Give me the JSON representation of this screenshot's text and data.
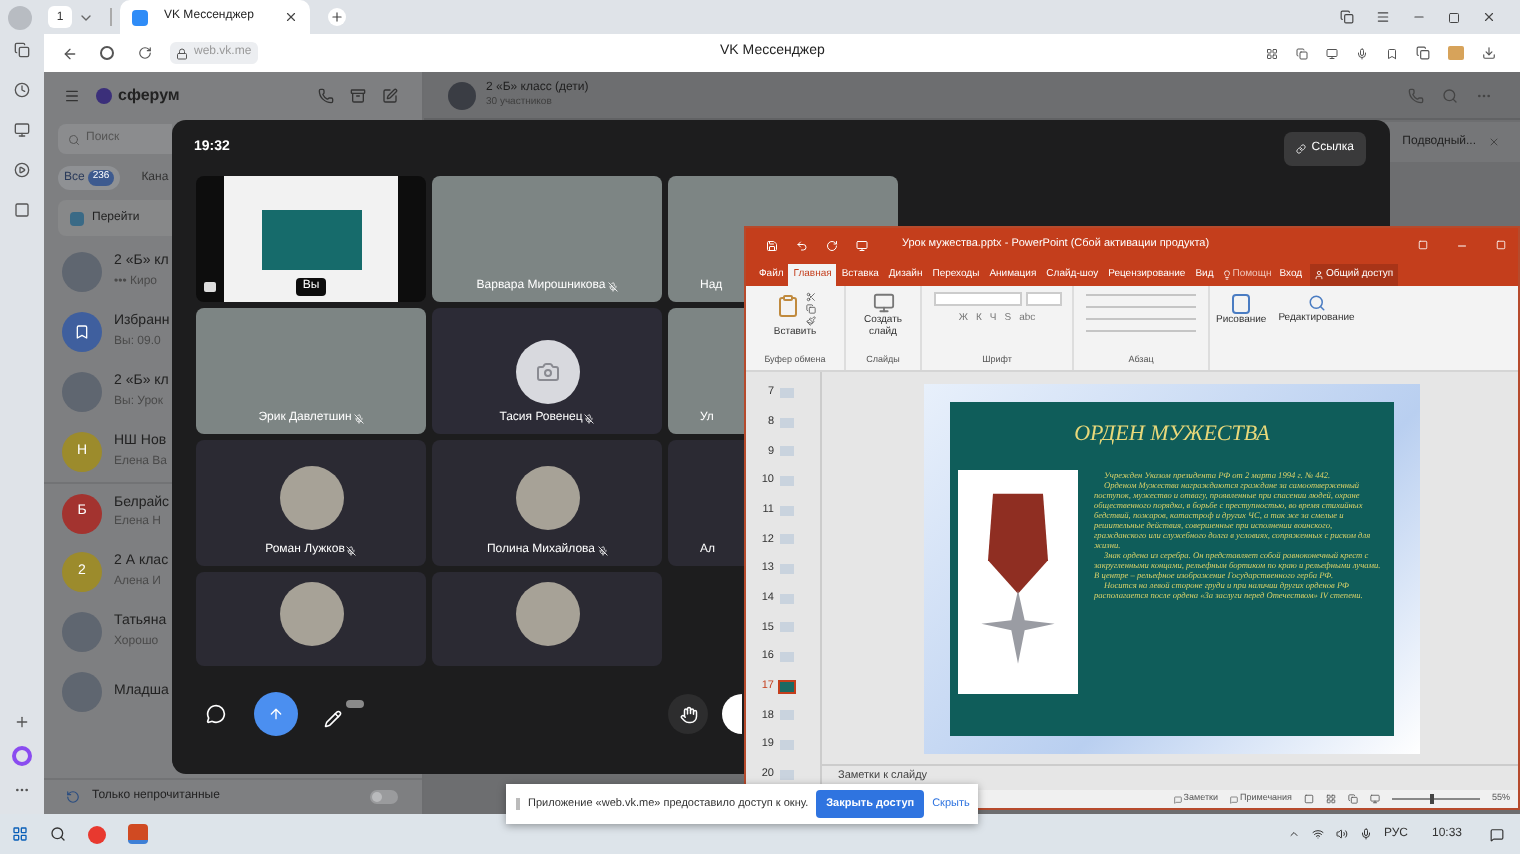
{
  "browser": {
    "tab_count": "1",
    "tab_title": "VK Мессенджер",
    "url": "web.vk.me",
    "page_title": "VK Мессенджер"
  },
  "sidebar": {
    "logo": "сферум",
    "search_placeholder": "Поиск",
    "filters": [
      {
        "label": "Все",
        "count": "236",
        "selected": true
      },
      {
        "label": "Кана",
        "selected": false
      }
    ],
    "banner": "Перейти",
    "chats": [
      {
        "name": "2 «Б» кл",
        "preview": "••• Киро",
        "avatar": {
          "kind": "photo"
        }
      },
      {
        "name": "Избранн",
        "preview": "Вы: 09.0",
        "avatar": {
          "kind": "bookmark",
          "color": "#3f5f9e"
        }
      },
      {
        "name": "2 «Б» кл",
        "preview": "Вы: Урок",
        "avatar": {
          "kind": "photo"
        }
      },
      {
        "name": "НШ Нов",
        "preview": "Елена Ва",
        "avatar": {
          "kind": "letter",
          "letter": "Н",
          "color": "#9c8b2c"
        }
      },
      {
        "name": "Белрайс",
        "preview": "Елена Н",
        "avatar": {
          "kind": "letter",
          "letter": "Б",
          "color": "#a3332f"
        }
      },
      {
        "name": "2 А клас",
        "preview": "Алена И",
        "avatar": {
          "kind": "letter",
          "letter": "2",
          "color": "#9c8b2c"
        }
      },
      {
        "name": "Татьяна",
        "preview": "Хорошо",
        "avatar": {
          "kind": "photo"
        }
      },
      {
        "name": "Младша",
        "avatar": {
          "kind": "photo"
        }
      }
    ],
    "unread_toggle": {
      "label": "Только непрочитанные",
      "on": false
    }
  },
  "chat_header": {
    "title": "2 «Б» класс (дети)",
    "subtitle": "30 участников",
    "pinned": "Подводный..."
  },
  "call": {
    "time": "19:32",
    "link_button": "Ссылка",
    "tiles": [
      {
        "kind": "screen",
        "name": "Вы",
        "muted": false
      },
      {
        "kind": "video",
        "name": "Варвара Мирошникова",
        "muted": true
      },
      {
        "kind": "video",
        "name": "Над",
        "muted": false
      },
      {
        "kind": "video",
        "name": "Эрик Давлетшин",
        "muted": true
      },
      {
        "kind": "camera_off",
        "name": "Тасия Ровенец",
        "muted": true
      },
      {
        "kind": "video",
        "name": "Ул",
        "muted": false
      },
      {
        "kind": "avatar",
        "name": "Роман Лужков",
        "muted": true
      },
      {
        "kind": "avatar",
        "name": "Полина Михайлова",
        "muted": true
      },
      {
        "kind": "avatar",
        "name": "Ал",
        "muted": false
      },
      {
        "kind": "avatar"
      },
      {
        "kind": "avatar"
      }
    ]
  },
  "powerpoint": {
    "title": "Урок мужества.pptx - PowerPoint (Сбой активации продукта)",
    "tabs": [
      {
        "label": "Файл",
        "selected": false
      },
      {
        "label": "Главная",
        "selected": true
      },
      {
        "label": "Вставка",
        "selected": false
      },
      {
        "label": "Дизайн",
        "selected": false
      },
      {
        "label": "Переходы",
        "selected": false
      },
      {
        "label": "Анимация",
        "selected": false
      },
      {
        "label": "Слайд-шоу",
        "selected": false
      },
      {
        "label": "Рецензирование",
        "selected": false
      },
      {
        "label": "Вид",
        "selected": false
      }
    ],
    "help": "Помощн",
    "signin": "Вход",
    "share": "Общий доступ",
    "paste": "Вставить",
    "new_slide": "Создать слайд",
    "font_buttons": [
      "Ж",
      "К",
      "Ч",
      "S",
      "abc"
    ],
    "drawing": "Рисование",
    "editing": "Редактирование",
    "groups": [
      "Буфер обмена",
      "Слайды",
      "Шрифт",
      "Абзац"
    ],
    "slides": [
      {
        "number": "7",
        "selected": false
      },
      {
        "number": "8",
        "selected": false
      },
      {
        "number": "9",
        "selected": false
      },
      {
        "number": "10",
        "selected": false
      },
      {
        "number": "11",
        "selected": false
      },
      {
        "number": "12",
        "selected": false
      },
      {
        "number": "13",
        "selected": false
      },
      {
        "number": "14",
        "selected": false
      },
      {
        "number": "15",
        "selected": false
      },
      {
        "number": "16",
        "selected": false
      },
      {
        "number": "17",
        "selected": true
      },
      {
        "number": "18",
        "selected": false
      },
      {
        "number": "19",
        "selected": false
      },
      {
        "number": "20",
        "selected": false
      }
    ],
    "slide": {
      "title": "ОРДЕН МУЖЕСТВА",
      "paragraphs": [
        "Учрежден Указом президента РФ от 2 марта 1994 г. № 442.",
        "Орденом Мужества награждаются граждане за самоотверженный поступок, мужество и отвагу, проявленные при спасении людей, охране общественного порядка, в борьбе с преступностью, во время стихийных бедствий, пожаров, катастроф и других ЧС, а так же за смелые и решительные действия, совершенные при исполнении воинского, гражданского или служебного долга в условиях, сопряженных с риском для жизни.",
        "Знак ордена из серебра. Он представляет собой равноконечный крест с закругленными концами, рельефным бортиком по краю и рельефными лучами. В центре – рельефное изображение Государственного герба РФ.",
        "Носится на левой стороне груди и при наличии других орденов РФ располагается после ордена «За заслуги перед Отечеством» IV степени."
      ]
    },
    "notes_placeholder": "Заметки к слайду",
    "status": {
      "notes": "Заметки",
      "comments": "Примечания",
      "zoom": "55%",
      "level": 0.45
    }
  },
  "notification": {
    "text": "Приложение «web.vk.me» предоставило доступ к окну.",
    "button": "Закрыть доступ",
    "link": "Скрыть"
  },
  "taskbar": {
    "language": "РУС",
    "time": "10:33"
  }
}
